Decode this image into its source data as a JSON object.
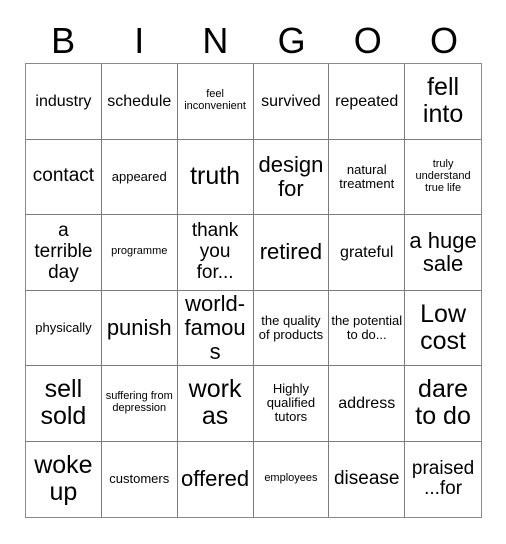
{
  "card": {
    "title": "BINGO Card",
    "header_letters": [
      "B",
      "I",
      "N",
      "G",
      "O",
      "O"
    ],
    "columns": 6,
    "rows": 6,
    "colors": {
      "background": "#ffffff",
      "text": "#000000",
      "grid_line": "#7d7d7d",
      "outer_border": "#8a8a8a"
    },
    "cells": [
      {
        "text": "industry",
        "size": "md"
      },
      {
        "text": "schedule",
        "size": "md"
      },
      {
        "text": "feel inconvenient",
        "size": "xs"
      },
      {
        "text": "survived",
        "size": "md"
      },
      {
        "text": "repeated",
        "size": "md"
      },
      {
        "text": "fell into",
        "size": "xxl"
      },
      {
        "text": "contact",
        "size": "lg"
      },
      {
        "text": "appeared",
        "size": "sm"
      },
      {
        "text": "truth",
        "size": "xxl"
      },
      {
        "text": "design for",
        "size": "xl"
      },
      {
        "text": "natural treatment",
        "size": "sm"
      },
      {
        "text": "truly understand true life",
        "size": "xs"
      },
      {
        "text": "a terrible day",
        "size": "lg"
      },
      {
        "text": "programme",
        "size": "xs"
      },
      {
        "text": "thank you for...",
        "size": "lg"
      },
      {
        "text": "retired",
        "size": "xl"
      },
      {
        "text": "grateful",
        "size": "md"
      },
      {
        "text": "a huge sale",
        "size": "xl"
      },
      {
        "text": "physically",
        "size": "sm"
      },
      {
        "text": "punish",
        "size": "xl"
      },
      {
        "text": "world-famous",
        "size": "xl"
      },
      {
        "text": "the quality of products",
        "size": "sm"
      },
      {
        "text": "the potential to do...",
        "size": "sm"
      },
      {
        "text": "Low cost",
        "size": "xxl"
      },
      {
        "text": "sell sold",
        "size": "xxl"
      },
      {
        "text": "suffering from depression",
        "size": "xs"
      },
      {
        "text": "work as",
        "size": "xxl"
      },
      {
        "text": "Highly qualified tutors",
        "size": "sm"
      },
      {
        "text": "address",
        "size": "md"
      },
      {
        "text": "dare to do",
        "size": "xxl"
      },
      {
        "text": "woke up",
        "size": "xxl"
      },
      {
        "text": "customers",
        "size": "sm"
      },
      {
        "text": "offered",
        "size": "xl"
      },
      {
        "text": "employees",
        "size": "xs"
      },
      {
        "text": "disease",
        "size": "lg"
      },
      {
        "text": "praised ...for",
        "size": "lg"
      }
    ]
  }
}
